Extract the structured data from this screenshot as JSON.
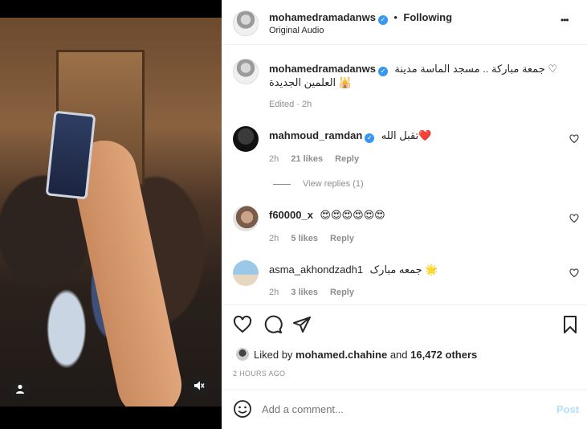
{
  "post": {
    "author": "mohamedramadanws",
    "follow_separator": "•",
    "follow_label": "Following",
    "audio": "Original Audio",
    "more_label": "•••"
  },
  "caption": {
    "author": "mohamedramadanws",
    "text_line1": "جمعة مباركة .. مسجد الماسة مدينة ♡",
    "text_line2": "العلمين الجديدة 🕌",
    "edited": "Edited · 2h"
  },
  "comments": [
    {
      "author": "mahmoud_ramdan",
      "verified": true,
      "text": "تقبل الله❤️",
      "time": "2h",
      "likes": "21 likes",
      "reply": "Reply",
      "view_replies": "View replies (1)"
    },
    {
      "author": "f60000_x",
      "verified": false,
      "text": "😍😍😍😍😍😍",
      "time": "2h",
      "likes": "5 likes",
      "reply": "Reply"
    },
    {
      "author": "asma_akhondzadh1",
      "verified": false,
      "text": "جمعه مبارک 🌟",
      "time": "2h",
      "likes": "3 likes",
      "reply": "Reply"
    }
  ],
  "likes": {
    "prefix": "Liked by",
    "user": "mohamed.chahine",
    "and": "and",
    "others": "16,472 others"
  },
  "timestamp": "2 HOURS AGO",
  "add_comment": {
    "placeholder": "Add a comment...",
    "post_label": "Post"
  },
  "icons": {
    "like": "heart-icon",
    "comment": "comment-icon",
    "share": "share-icon",
    "save": "bookmark-icon",
    "emoji": "emoji-icon",
    "tag": "user-tag-icon",
    "mute": "mute-icon"
  },
  "colors": {
    "verified": "#3897f0",
    "post_button": "#b2dffc",
    "muted_text": "#8e8e8e"
  }
}
